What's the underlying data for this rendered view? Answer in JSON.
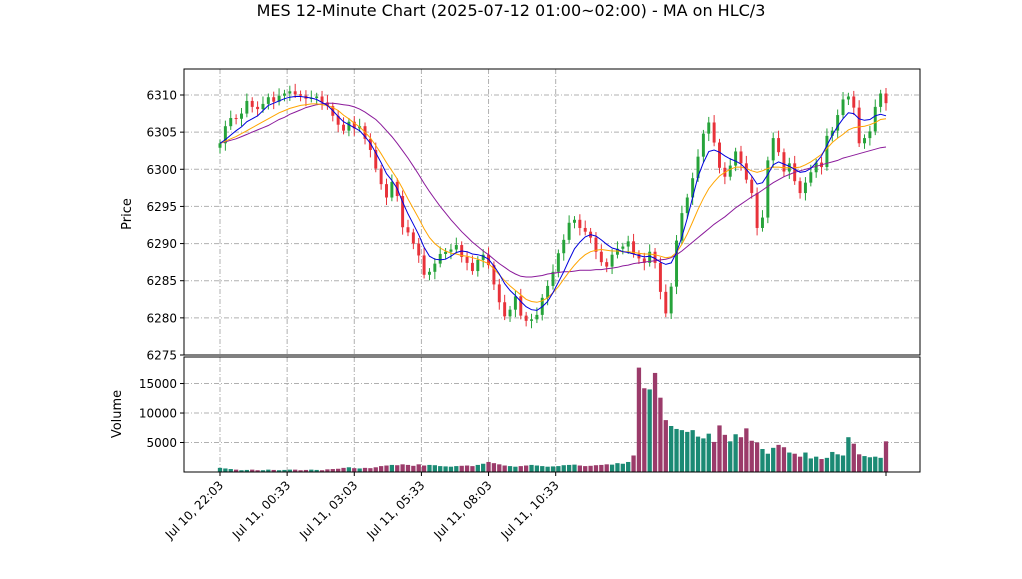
{
  "title": "MES 12-Minute Chart (2025-07-12 01:00~02:00) - MA on HLC/3",
  "colors": {
    "up": "#26a33a",
    "down": "#e8323a",
    "vol_up": "#1b8a74",
    "vol_down": "#9b3b6a",
    "ma_fast": "#0000dd",
    "ma_mid": "#ffa500",
    "ma_slow": "#8b1a9b",
    "grid": "#b0b0b0"
  },
  "chart_data": {
    "type": "candlestick",
    "title": "MES 12-Minute Chart (2025-07-12 01:00~02:00) - MA on HLC/3",
    "ylabel": "Price",
    "ylabel2": "Volume",
    "ylim": [
      6275,
      6313.5
    ],
    "ylim2": [
      0,
      19500
    ],
    "yticks": [
      6275,
      6280,
      6285,
      6290,
      6295,
      6300,
      6305,
      6310
    ],
    "yticks2": [
      5000,
      10000,
      15000
    ],
    "xticks": [
      "Jul 10, 22:03",
      "Jul 11, 00:33",
      "Jul 11, 03:03",
      "Jul 11, 05:33",
      "Jul 11, 08:03",
      "Jul 11, 10:33"
    ],
    "bars_per_xtick": 12.5,
    "grid": true,
    "close": [
      6303.5,
      6305.8,
      6306.9,
      6306.8,
      6307.5,
      6309.2,
      6308.4,
      6308.1,
      6308.8,
      6309.7,
      6309.1,
      6309.9,
      6310.2,
      6310.5,
      6310.1,
      6309.9,
      6309.5,
      6309.6,
      6309.8,
      6309.0,
      6308.5,
      6307.2,
      6306.0,
      6305.2,
      6306.4,
      6305.5,
      6305.8,
      6304.1,
      6302.6,
      6300.1,
      6298.0,
      6296.2,
      6298.3,
      6296.4,
      6292.2,
      6291.5,
      6290.0,
      6288.4,
      6285.8,
      6286.2,
      6287.3,
      6288.6,
      6288.9,
      6289.2,
      6289.8,
      6288.2,
      6287.4,
      6286.3,
      6287.8,
      6288.5,
      6287.1,
      6284.5,
      6282.1,
      6280.2,
      6281.1,
      6282.9,
      6280.3,
      6279.6,
      6279.8,
      6280.4,
      6282.7,
      6284.3,
      6286.2,
      6288.7,
      6290.5,
      6292.8,
      6293.2,
      6292.1,
      6291.6,
      6290.8,
      6288.9,
      6287.5,
      6286.9,
      6288.5,
      6289.3,
      6289.6,
      6290.3,
      6288.6,
      6288.0,
      6287.4,
      6288.9,
      6287.4,
      6283.5,
      6280.6,
      6284.2,
      6290.4,
      6294.1,
      6296.2,
      6298.8,
      6301.7,
      6304.8,
      6306.3,
      6303.6,
      6300.2,
      6299.0,
      6300.5,
      6302.4,
      6300.8,
      6298.6,
      6296.8,
      6292.1,
      6293.5,
      6301.2,
      6304.2,
      6302.3,
      6299.7,
      6300.8,
      6298.4,
      6296.8,
      6298.2,
      6299.6,
      6300.9,
      6300.3,
      6304.5,
      6305.2,
      6307.3,
      6309.4,
      6309.8,
      6308.3,
      6303.5,
      6304.2,
      6305.1,
      6308.4,
      6310.2,
      6308.9
    ],
    "ma_fast": [
      6303.5,
      6304.0,
      6304.6,
      6305.2,
      6305.7,
      6306.4,
      6306.8,
      6307.2,
      6307.9,
      6308.6,
      6308.9,
      6309.2,
      6309.5,
      6309.7,
      6309.8,
      6309.8,
      6309.7,
      6309.6,
      6309.4,
      6309.0,
      6308.6,
      6307.9,
      6307.1,
      6306.4,
      6306.0,
      6305.6,
      6305.2,
      6304.4,
      6303.5,
      6302.2,
      6300.9,
      6299.4,
      6298.5,
      6297.4,
      6295.6,
      6294.0,
      6292.6,
      6291.2,
      6289.5,
      6288.3,
      6287.9,
      6287.8,
      6287.9,
      6288.3,
      6288.8,
      6289.0,
      6288.9,
      6288.6,
      6288.5,
      6288.3,
      6287.9,
      6287.0,
      6285.9,
      6284.6,
      6283.7,
      6283.0,
      6282.2,
      6281.5,
      6281.1,
      6281.0,
      6281.5,
      6282.2,
      6283.4,
      6284.8,
      6286.2,
      6287.8,
      6289.3,
      6290.2,
      6290.9,
      6291.2,
      6291.0,
      6290.5,
      6289.9,
      6289.4,
      6289.2,
      6288.9,
      6288.8,
      6288.6,
      6288.4,
      6288.2,
      6288.3,
      6288.0,
      6287.5,
      6287.2,
      6287.4,
      6288.8,
      6290.9,
      6293.4,
      6296.2,
      6299.0,
      6300.9,
      6302.4,
      6302.6,
      6302.3,
      6301.8,
      6301.4,
      6301.1,
      6300.7,
      6300.0,
      6299.1,
      6298.0,
      6298.2,
      6299.3,
      6300.6,
      6301.0,
      6300.7,
      6300.4,
      6300.0,
      6299.6,
      6299.7,
      6300.1,
      6300.9,
      6301.8,
      6303.2,
      6304.6,
      6305.8,
      6306.8,
      6307.6,
      6307.5,
      6306.8,
      6306.6,
      6306.7,
      6307.2,
      6307.4,
      6307.2
    ],
    "ma_mid": [
      6303.5,
      6303.8,
      6304.1,
      6304.4,
      6304.8,
      6305.2,
      6305.6,
      6306.0,
      6306.4,
      6306.8,
      6307.2,
      6307.6,
      6307.9,
      6308.2,
      6308.4,
      6308.6,
      6308.7,
      6308.8,
      6308.8,
      6308.7,
      6308.6,
      6308.3,
      6307.9,
      6307.3,
      6306.8,
      6306.2,
      6305.7,
      6305.0,
      6304.2,
      6303.2,
      6302.1,
      6300.9,
      6299.8,
      6298.7,
      6297.4,
      6296.0,
      6294.7,
      6293.4,
      6292.0,
      6290.8,
      6290.0,
      6289.4,
      6289.0,
      6288.7,
      6288.6,
      6288.4,
      6288.3,
      6288.1,
      6287.9,
      6287.6,
      6287.3,
      6286.6,
      6285.8,
      6285.0,
      6284.3,
      6283.7,
      6283.1,
      6282.5,
      6282.2,
      6282.1,
      6282.3,
      6282.7,
      6283.4,
      6284.2,
      6285.2,
      6286.2,
      6287.1,
      6287.9,
      6288.5,
      6288.9,
      6289.1,
      6289.2,
      6289.1,
      6289.0,
      6289.0,
      6288.9,
      6288.9,
      6288.8,
      6288.7,
      6288.6,
      6288.6,
      6288.5,
      6288.3,
      6288.1,
      6288.2,
      6288.8,
      6289.9,
      6291.3,
      6292.9,
      6294.6,
      6296.1,
      6297.4,
      6298.3,
      6299.1,
      6299.6,
      6300.0,
      6300.3,
      6300.3,
      6300.1,
      6299.8,
      6299.6,
      6299.8,
      6300.1,
      6300.3,
      6300.3,
      6300.2,
      6300.2,
      6300.2,
      6300.3,
      6300.6,
      6301.0,
      6301.5,
      6302.0,
      6302.8,
      6303.6,
      6304.2,
      6304.7,
      6305.3,
      6305.6,
      6305.7,
      6305.8,
      6306.0,
      6306.3,
      6306.7,
      6306.8
    ],
    "ma_slow": [
      6303.5,
      6303.7,
      6303.9,
      6304.1,
      6304.4,
      6304.7,
      6305.0,
      6305.3,
      6305.6,
      6305.9,
      6306.3,
      6306.7,
      6307.0,
      6307.4,
      6307.7,
      6308.0,
      6308.3,
      6308.5,
      6308.7,
      6308.8,
      6308.9,
      6308.9,
      6308.8,
      6308.7,
      6308.6,
      6308.4,
      6308.1,
      6307.7,
      6307.2,
      6306.7,
      6306.0,
      6305.2,
      6304.4,
      6303.5,
      6302.5,
      6301.5,
      6300.4,
      6299.3,
      6298.1,
      6297.0,
      6296.0,
      6295.0,
      6294.1,
      6293.2,
      6292.4,
      6291.6,
      6290.9,
      6290.2,
      6289.6,
      6289.0,
      6288.5,
      6287.9,
      6287.3,
      6286.8,
      6286.3,
      6285.9,
      6285.6,
      6285.5,
      6285.5,
      6285.6,
      6285.7,
      6285.9,
      6286.0,
      6286.1,
      6286.2,
      6286.2,
      6286.3,
      6286.4,
      6286.4,
      6286.4,
      6286.5,
      6286.5,
      6286.6,
      6286.7,
      6286.8,
      6287.0,
      6287.1,
      6287.3,
      6287.4,
      6287.5,
      6287.6,
      6287.7,
      6287.8,
      6287.9,
      6288.1,
      6288.5,
      6289.0,
      6289.6,
      6290.2,
      6290.8,
      6291.4,
      6292.0,
      6292.6,
      6293.1,
      6293.6,
      6294.2,
      6294.8,
      6295.3,
      6295.8,
      6296.3,
      6296.7,
      6297.2,
      6297.7,
      6298.2,
      6298.6,
      6299.0,
      6299.3,
      6299.6,
      6299.8,
      6300.0,
      6300.2,
      6300.4,
      6300.6,
      6300.8,
      6301.0,
      6301.2,
      6301.5,
      6301.7,
      6301.9,
      6302.1,
      6302.3,
      6302.5,
      6302.7,
      6302.9,
      6303.0
    ],
    "volume": [
      700,
      600,
      500,
      400,
      300,
      350,
      400,
      300,
      300,
      400,
      350,
      300,
      350,
      400,
      400,
      300,
      350,
      400,
      350,
      300,
      450,
      500,
      550,
      700,
      800,
      650,
      600,
      700,
      650,
      800,
      1000,
      1100,
      1200,
      1150,
      1300,
      1200,
      1050,
      1300,
      1100,
      1200,
      1150,
      1000,
      950,
      900,
      1000,
      1050,
      1100,
      1000,
      1200,
      1400,
      1700,
      1500,
      1300,
      1100,
      1000,
      900,
      1000,
      1100,
      1200,
      1100,
      1000,
      900,
      950,
      1000,
      1150,
      1200,
      1250,
      1100,
      1000,
      1050,
      1150,
      1200,
      1300,
      1250,
      1500,
      1400,
      1700,
      2800,
      17700,
      14200,
      14000,
      16800,
      12600,
      8800,
      7800,
      7300,
      7100,
      6800,
      7100,
      6000,
      5700,
      6500,
      5100,
      7900,
      6300,
      5200,
      6400,
      5900,
      7400,
      5300,
      5000,
      3900,
      3100,
      4100,
      4600,
      4200,
      3300,
      3100,
      2600,
      3300,
      2300,
      2600,
      2200,
      2400,
      3400,
      3000,
      2800,
      5900,
      4800,
      3000,
      2700,
      2500,
      2600,
      2400,
      5200
    ]
  }
}
